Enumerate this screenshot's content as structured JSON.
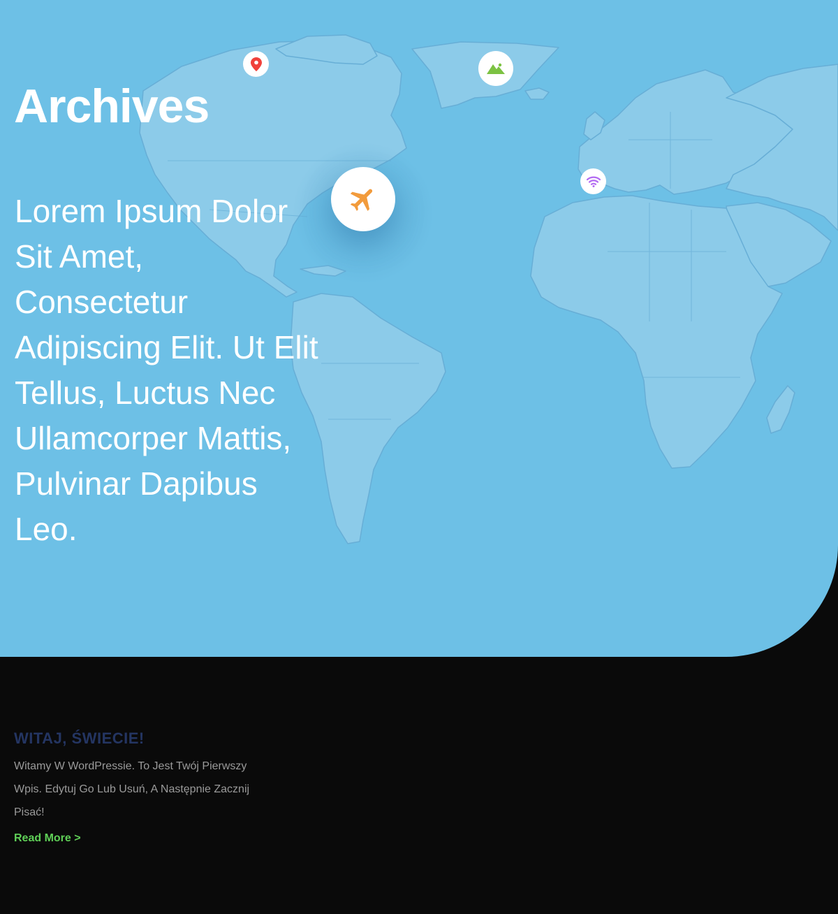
{
  "colors": {
    "hero_background": "#6dc0e6",
    "land": "#8ccbe9",
    "page_background": "#0a0a0a",
    "post_title": "#243562",
    "read_more": "#5fcf57",
    "plane_icon": "#f29b3c",
    "location_icon": "#f0413b",
    "mountain_icon": "#7cc242",
    "wifi_icon": "#b36cf2"
  },
  "hero": {
    "title": "Archives",
    "text": "Lorem Ipsum Dolor Sit Amet, Consectetur Adipiscing Elit. Ut Elit Tellus, Luctus Nec Ullamcorper Mattis, Pulvinar Dapibus Leo.",
    "map_markers": [
      {
        "icon": "location-pin-icon"
      },
      {
        "icon": "mountain-icon"
      },
      {
        "icon": "airplane-icon"
      },
      {
        "icon": "wifi-icon"
      }
    ]
  },
  "post": {
    "title": "WITAJ, ŚWIECIE!",
    "excerpt": "Witamy W WordPressie. To Jest Twój Pierwszy Wpis. Edytuj Go Lub Usuń, A Następnie Zacznij Pisać!",
    "read_more_label": "Read More >"
  }
}
